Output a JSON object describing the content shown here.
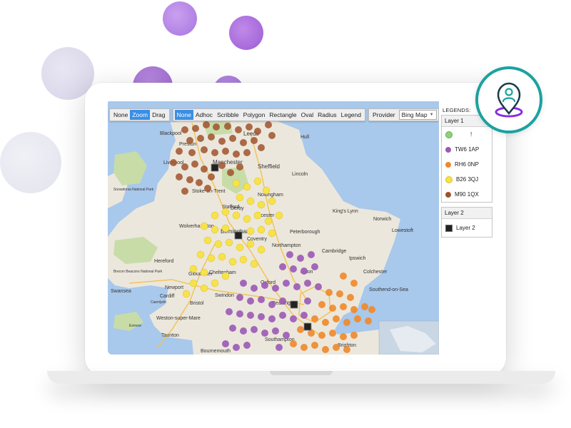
{
  "toolbar": {
    "mode_group": [
      {
        "label": "None",
        "active": false
      },
      {
        "label": "Zoom",
        "active": true
      },
      {
        "label": "Drag",
        "active": false
      }
    ],
    "draw_group": [
      {
        "label": "None",
        "active": true
      },
      {
        "label": "Adhoc",
        "active": false
      },
      {
        "label": "Scribble",
        "active": false
      },
      {
        "label": "Polygon",
        "active": false
      },
      {
        "label": "Rectangle",
        "active": false
      },
      {
        "label": "Oval",
        "active": false
      },
      {
        "label": "Radius",
        "active": false
      },
      {
        "label": "Legend",
        "active": false
      }
    ],
    "provider_label": "Provider",
    "provider_value": "Bing Map"
  },
  "legend": {
    "title": "LEGENDS:",
    "layer1": {
      "title": "Layer 1",
      "items": [
        {
          "label": "!",
          "color": "#8fd17a"
        },
        {
          "label": "TW6 1AP",
          "color": "#9b59b6"
        },
        {
          "label": "RH6 0NP",
          "color": "#f0882a"
        },
        {
          "label": "B26 3QJ",
          "color": "#f7e24a"
        },
        {
          "label": "M90 1QX",
          "color": "#a0522d"
        }
      ]
    },
    "layer2": {
      "title": "Layer 2",
      "items": [
        {
          "label": "Layer 2",
          "color": "#222222"
        }
      ]
    }
  },
  "map_labels": [
    "Blackpool",
    "Preston",
    "Liverpool",
    "Manchester",
    "Sheffield",
    "Hull",
    "Lincoln",
    "Leeds",
    "Derby",
    "Nottingham",
    "Stoke-on-Trent",
    "Stafford",
    "Leicester",
    "Wolverhampton",
    "Birmingham",
    "Coventry",
    "Peterborough",
    "Norwich",
    "King's Lynn",
    "Lowestoft",
    "Northampton",
    "Cambridge",
    "Ipswich",
    "Colchester",
    "Hereford",
    "Gloucester",
    "Cheltenham",
    "Oxford",
    "Luton",
    "Swindon",
    "Reading",
    "Swansea",
    "Cardiff",
    "Newport",
    "Bristol",
    "Weston-super-Mare",
    "Taunton",
    "Southend-on-Sea",
    "Southampton",
    "Brighton",
    "Bournemouth",
    "Brecon Beacons National Park",
    "Snowdonia National Park",
    "Exmoor",
    "Caerdydd"
  ],
  "colors": {
    "water": "#a8c8ec",
    "land": "#ece7dc",
    "green": "#c8dca8",
    "teal_accent": "#1ba2a0",
    "purple_accent": "#8a2be2"
  },
  "icons": {
    "badge": "map-pin-user-icon"
  }
}
